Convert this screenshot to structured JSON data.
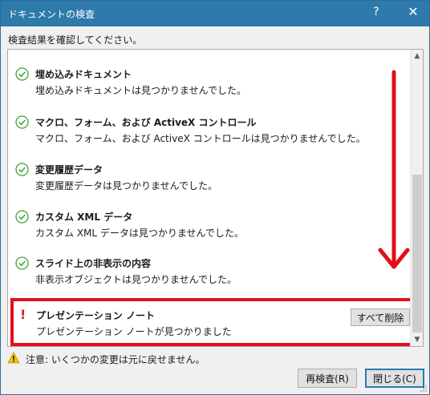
{
  "window": {
    "title": "ドキュメントの検査",
    "help_glyph": "?",
    "close_glyph": "✕"
  },
  "instruction": "検査結果を確認してください。",
  "results": [
    {
      "title": "埋め込みドキュメント",
      "desc": "埋め込みドキュメントは見つかりませんでした。",
      "status": "ok",
      "icon": "check-circle-icon"
    },
    {
      "title": "マクロ、フォーム、および ActiveX コントロール",
      "desc": "マクロ、フォーム、および ActiveX コントロールは見つかりませんでした。",
      "status": "ok",
      "icon": "check-circle-icon"
    },
    {
      "title": "変更履歴データ",
      "desc": "変更履歴データは見つかりませんでした。",
      "status": "ok",
      "icon": "check-circle-icon"
    },
    {
      "title": "カスタム XML データ",
      "desc": "カスタム XML データは見つかりませんでした。",
      "status": "ok",
      "icon": "check-circle-icon"
    },
    {
      "title": "スライド上の非表示の内容",
      "desc": "非表示オブジェクトは見つかりませんでした。",
      "status": "ok",
      "icon": "check-circle-icon"
    }
  ],
  "presenter_notes": {
    "mark": "!",
    "title": "プレゼンテーション ノート",
    "desc": "プレゼンテーション ノートが見つかりました",
    "action_label": "すべて削除",
    "status": "found"
  },
  "warning": "注意: いくつかの変更は元に戻せません。",
  "buttons": {
    "recheck": "再検査(R)",
    "close": "閉じる(C)"
  },
  "colors": {
    "titlebar": "#2d7aab",
    "ok_green": "#3aa53a",
    "highlight_red": "#e0101a",
    "warning_yellow": "#f2c200"
  }
}
